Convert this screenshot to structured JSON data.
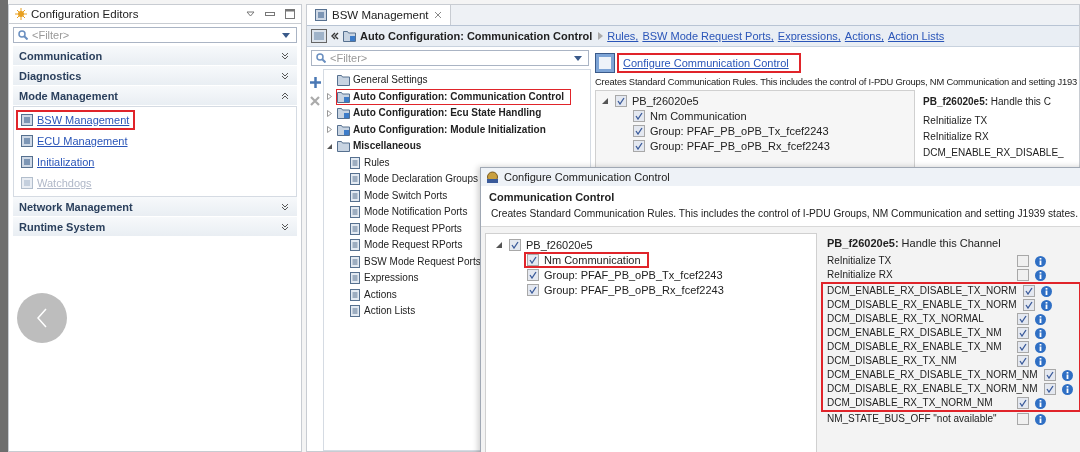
{
  "config_editors": {
    "title": "Configuration Editors",
    "filter_placeholder": "<Filter>",
    "sections": [
      {
        "label": "Communication",
        "expanded": false
      },
      {
        "label": "Diagnostics",
        "expanded": false
      },
      {
        "label": "Mode Management",
        "expanded": true,
        "items": [
          {
            "label": "BSW Management",
            "disabled": false,
            "highlighted": true
          },
          {
            "label": "ECU Management",
            "disabled": false,
            "highlighted": false
          },
          {
            "label": "Initialization",
            "disabled": false,
            "highlighted": false
          },
          {
            "label": "Watchdogs",
            "disabled": true,
            "highlighted": false
          }
        ]
      },
      {
        "label": "Network Management",
        "expanded": false
      },
      {
        "label": "Runtime System",
        "expanded": false
      }
    ]
  },
  "editor": {
    "tab": "BSW Management",
    "breadcrumb": {
      "current": "Auto Configuration: Communication Control",
      "links": [
        "Rules,",
        "BSW Mode Request Ports,",
        "Expressions,",
        "Actions,",
        "Action Lists"
      ]
    },
    "filter_placeholder": "<Filter>",
    "tree": [
      {
        "label": "General Settings",
        "bold": false,
        "highlighted": false
      },
      {
        "label": "Auto Configuration: Communication Control",
        "bold": true,
        "expanded": false,
        "highlighted": true
      },
      {
        "label": "Auto Configuration: Ecu State Handling",
        "bold": true,
        "expanded": false,
        "highlighted": false
      },
      {
        "label": "Auto Configuration: Module Initialization",
        "bold": true,
        "expanded": false,
        "highlighted": false
      },
      {
        "label": "Miscellaneous",
        "bold": true,
        "expanded": true,
        "highlighted": false,
        "children": [
          {
            "label": "Rules",
            "bold": false,
            "highlighted": false
          },
          {
            "label": "Mode Declaration Groups",
            "bold": false,
            "highlighted": false
          },
          {
            "label": "Mode Switch Ports",
            "bold": false,
            "highlighted": false
          },
          {
            "label": "Mode Notification Ports",
            "bold": false,
            "highlighted": false
          },
          {
            "label": "Mode Request PPorts",
            "bold": false,
            "highlighted": false
          },
          {
            "label": "Mode Request RPorts",
            "bold": false,
            "highlighted": false
          },
          {
            "label": "BSW Mode Request Ports",
            "bold": false,
            "highlighted": false
          },
          {
            "label": "Expressions",
            "bold": false,
            "highlighted": false
          },
          {
            "label": "Actions",
            "bold": false,
            "highlighted": false
          },
          {
            "label": "Action Lists",
            "bold": false,
            "highlighted": false
          }
        ]
      }
    ],
    "page": {
      "link": "Configure Communication Control",
      "link_highlighted": true,
      "description": "Creates Standard Communication Rules. This includes the control of I-PDU Groups, NM Communication and setting J193",
      "tree": [
        {
          "label": "PB_f26020e5",
          "checked": true,
          "expanded": true,
          "highlighted": false,
          "children": [
            {
              "label": "Nm Communication",
              "checked": true,
              "highlighted": false
            },
            {
              "label": "Group: PFAF_PB_oPB_Tx_fcef2243",
              "checked": true,
              "highlighted": false
            },
            {
              "label": "Group: PFAF_PB_oPB_Rx_fcef2243",
              "checked": true,
              "highlighted": false
            }
          ]
        }
      ],
      "options_heading": "**PB_f26020e5:** Handle this C",
      "options": [
        "ReInitialize TX",
        "ReInitialize RX",
        "DCM_ENABLE_RX_DISABLE_"
      ]
    }
  },
  "dialog": {
    "title": "Configure Communication Control",
    "heading": "Communication Control",
    "description": "Creates Standard Communication Rules. This includes the control of I-PDU Groups, NM Communication and setting J1939 states.",
    "tree": [
      {
        "label": "PB_f26020e5",
        "checked": true,
        "expanded": true,
        "highlighted": false,
        "children": [
          {
            "label": "Nm Communication",
            "checked": true,
            "highlighted": true
          },
          {
            "label": "Group: PFAF_PB_oPB_Tx_fcef2243",
            "checked": true,
            "highlighted": false
          },
          {
            "label": "Group: PFAF_PB_oPB_Rx_fcef2243",
            "checked": true,
            "highlighted": false
          }
        ]
      }
    ],
    "options_heading": "**PB_f26020e5:** Handle this Channel",
    "options": [
      {
        "label": "ReInitialize TX",
        "checked": false,
        "highlighted": false
      },
      {
        "label": "ReInitialize RX",
        "checked": false,
        "highlighted": false
      },
      {
        "label": "DCM_ENABLE_RX_DISABLE_TX_NORM",
        "checked": true,
        "highlighted": true
      },
      {
        "label": "DCM_DISABLE_RX_ENABLE_TX_NORM",
        "checked": true,
        "highlighted": true
      },
      {
        "label": "DCM_DISABLE_RX_TX_NORMAL",
        "checked": true,
        "highlighted": true
      },
      {
        "label": "DCM_ENABLE_RX_DISABLE_TX_NM",
        "checked": true,
        "highlighted": true
      },
      {
        "label": "DCM_DISABLE_RX_ENABLE_TX_NM",
        "checked": true,
        "highlighted": true
      },
      {
        "label": "DCM_DISABLE_RX_TX_NM",
        "checked": true,
        "highlighted": true
      },
      {
        "label": "DCM_ENABLE_RX_DISABLE_TX_NORM_NM",
        "checked": true,
        "highlighted": true
      },
      {
        "label": "DCM_DISABLE_RX_ENABLE_TX_NORM_NM",
        "checked": true,
        "highlighted": true
      },
      {
        "label": "DCM_DISABLE_RX_TX_NORM_NM",
        "checked": true,
        "highlighted": true
      },
      {
        "label": "NM_STATE_BUS_OFF \"not available\"",
        "checked": false,
        "highlighted": false
      }
    ]
  }
}
